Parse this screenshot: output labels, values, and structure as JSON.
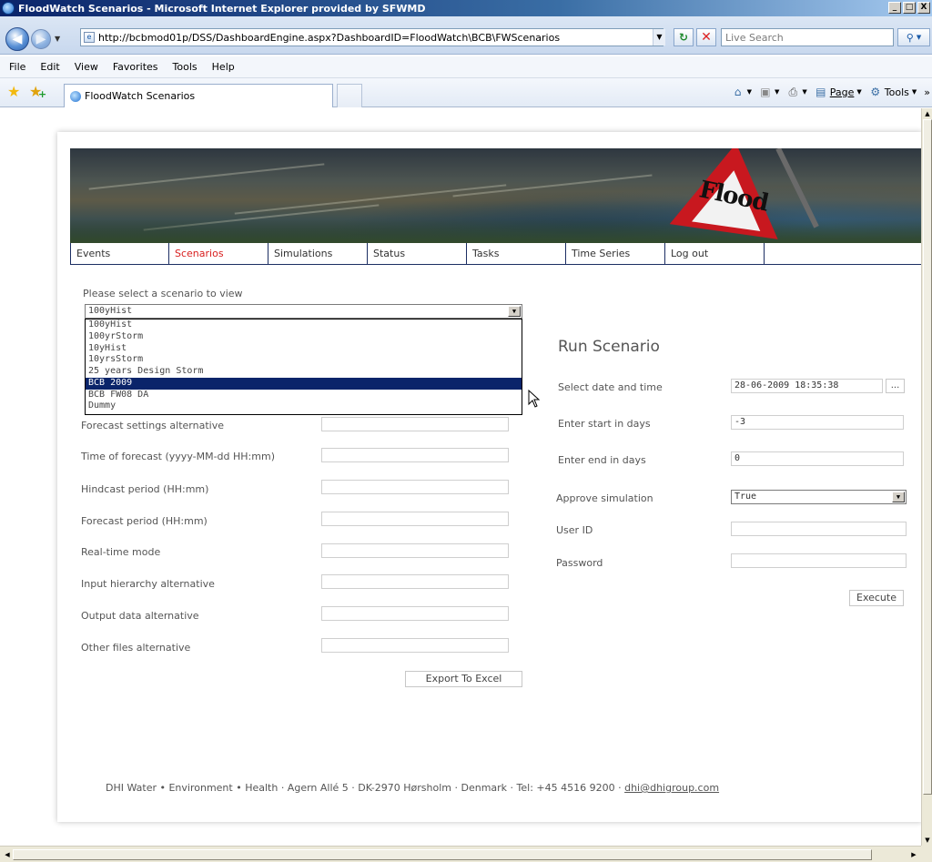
{
  "window": {
    "title": "FloodWatch Scenarios - Microsoft Internet Explorer provided by SFWMD",
    "min": "_",
    "max": "□",
    "close": "X"
  },
  "address": {
    "url": "http://bcbmod01p/DSS/DashboardEngine.aspx?DashboardID=FloodWatch\\BCB\\FWScenarios",
    "search_placeholder": "Live Search"
  },
  "menu": [
    "File",
    "Edit",
    "View",
    "Favorites",
    "Tools",
    "Help"
  ],
  "tabs": {
    "active_title": "FloodWatch Scenarios"
  },
  "commandbar": {
    "page": "Page",
    "tools": "Tools"
  },
  "banner": {
    "sign_text": "Flood"
  },
  "nav": [
    "Events",
    "Scenarios",
    "Simulations",
    "Status",
    "Tasks",
    "Time Series",
    "Log out"
  ],
  "nav_active": "Scenarios",
  "scenario": {
    "prompt": "Please select a scenario to view",
    "selected": "100yHist",
    "options": [
      "100yHist",
      "100yrStorm",
      "10yHist",
      "10yrsStorm",
      "25 years Design Storm",
      "BCB 2009",
      "BCB FW08 DA",
      "Dummy"
    ],
    "highlighted": "BCB 2009"
  },
  "details": {
    "labels": [
      "Forecast settings alternative",
      "Time of forecast (yyyy-MM-dd HH:mm)",
      "Hindcast period (HH:mm)",
      "Forecast period (HH:mm)",
      "Real-time mode",
      "Input hierarchy alternative",
      "Output data alternative",
      "Other files alternative"
    ],
    "export_button": "Export To Excel"
  },
  "run": {
    "heading": "Run Scenario",
    "date_label": "Select date and time",
    "date_value": "28-06-2009 18:35:38",
    "date_button": "...",
    "start_label": "Enter start in days",
    "start_value": "-3",
    "end_label": "Enter end in days",
    "end_value": "0",
    "approve_label": "Approve simulation",
    "approve_value": "True",
    "user_label": "User ID",
    "password_label": "Password",
    "execute_button": "Execute"
  },
  "footer": {
    "text": "DHI Water • Environment • Health · Agern Allé 5 · DK-2970 Hørsholm · Denmark · Tel: +45 4516 9200 ·",
    "email": "dhi@dhigroup.com"
  }
}
